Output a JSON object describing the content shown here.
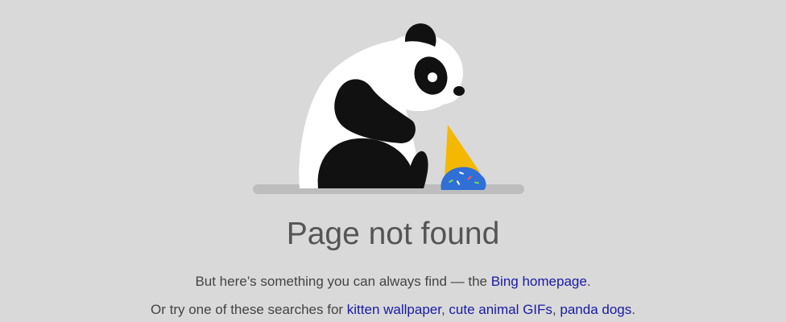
{
  "error": {
    "title": "Page not found"
  },
  "message_line_1": {
    "prefix": "But here’s something you can always find — the ",
    "link": "Bing homepage",
    "suffix": "."
  },
  "message_line_2": {
    "prefix": "Or try one of these searches for ",
    "links": [
      "kitten wallpaper",
      "cute animal GIFs",
      "panda dogs"
    ],
    "separator": ", ",
    "suffix": "."
  },
  "icons": {
    "illustration": "sad-panda-dropped-ice-cream-icon"
  },
  "colors": {
    "background": "#d9d9d9",
    "link": "#1a1aa6",
    "title": "#555555",
    "cone": "#f5b800",
    "ice_cream": "#2f6fd6"
  }
}
